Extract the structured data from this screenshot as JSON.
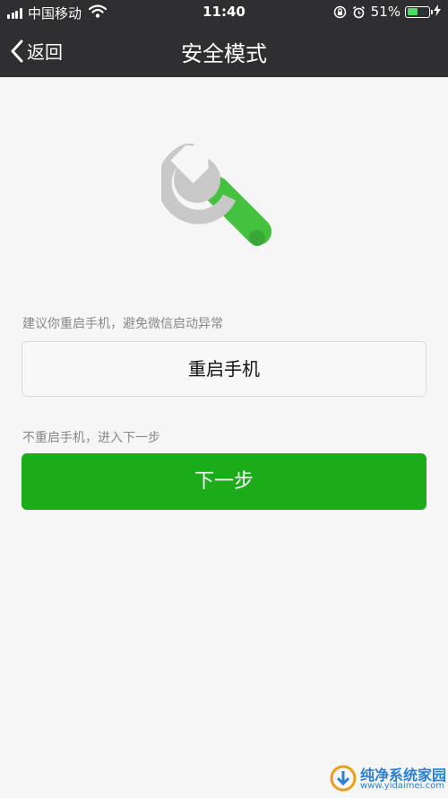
{
  "status_bar": {
    "carrier": "中国移动",
    "time": "11:40",
    "battery_percent": "51%",
    "battery_level": 0.51,
    "battery_color": "#4cd964"
  },
  "nav": {
    "back_label": "返回",
    "title": "安全模式",
    "bg_color": "#2f2f31"
  },
  "main": {
    "icon": "wrench-icon",
    "restart_hint": "建议你重启手机，避免微信启动异常",
    "restart_button": "重启手机",
    "next_hint": "不重启手机，进入下一步",
    "next_button": "下一步",
    "accent_color": "#1aad19"
  },
  "watermark": {
    "text": "纯净系统家园",
    "url": "www.yidaimei.com"
  }
}
